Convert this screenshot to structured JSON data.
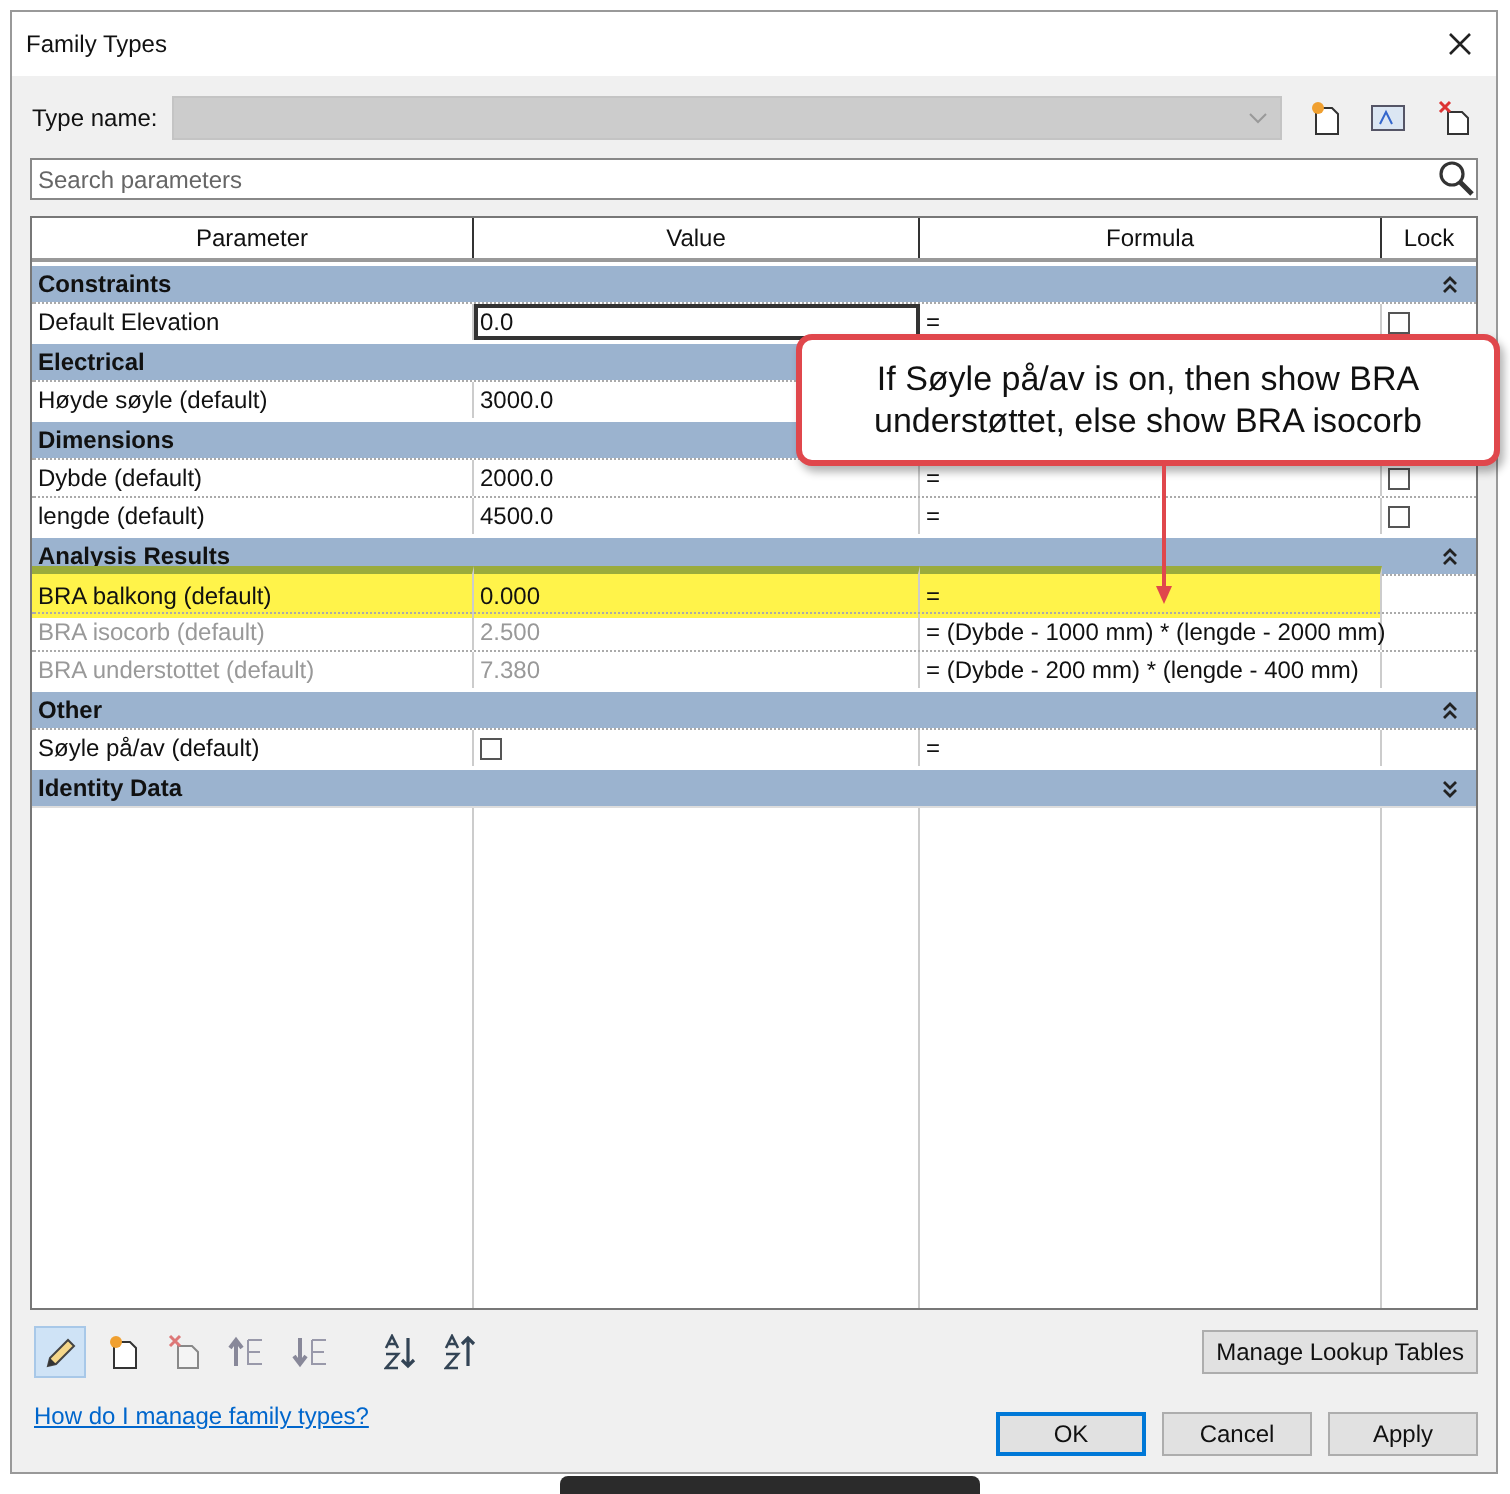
{
  "window": {
    "title": "Family Types"
  },
  "type_name": {
    "label": "Type name:"
  },
  "search": {
    "placeholder": "Search parameters"
  },
  "table": {
    "columns": [
      "Parameter",
      "Value",
      "Formula",
      "Lock"
    ],
    "groups": [
      {
        "name": "Constraints",
        "expanded": true,
        "rows": [
          {
            "parameter": "Default Elevation",
            "kind": "text",
            "value": "0.0",
            "editing": true,
            "formula": "=",
            "locked": false,
            "disabled": false,
            "highlighted": false
          }
        ]
      },
      {
        "name": "Electrical",
        "rows": [
          {
            "parameter": "Høyde søyle (default)",
            "kind": "text",
            "value": "3000.0",
            "editing": false,
            "disabled": false,
            "highlighted": false
          }
        ]
      },
      {
        "name": "Dimensions",
        "rows": [
          {
            "parameter": "Dybde (default)",
            "kind": "text",
            "value": "2000.0",
            "editing": false,
            "formula": "=",
            "locked": false,
            "disabled": false,
            "highlighted": false
          },
          {
            "parameter": "lengde (default)",
            "kind": "text",
            "value": "4500.0",
            "editing": false,
            "formula": "=",
            "locked": false,
            "disabled": false,
            "highlighted": false
          }
        ]
      },
      {
        "name": "Analysis Results",
        "expanded": true,
        "rows": [
          {
            "parameter": "BRA balkong (default)",
            "kind": "text",
            "value": "0.000",
            "editing": false,
            "formula": "=",
            "disabled": false,
            "highlighted": true
          },
          {
            "parameter": "BRA isocorb (default)",
            "kind": "text",
            "value": "2.500",
            "editing": false,
            "formula": "= (Dybde - 1000 mm) * (lengde - 2000 mm)",
            "disabled": true,
            "highlighted": false
          },
          {
            "parameter": "BRA understottet (default)",
            "kind": "text",
            "value": "7.380",
            "editing": false,
            "formula": "= (Dybde - 200 mm) * (lengde - 400 mm)",
            "disabled": true,
            "highlighted": false
          }
        ]
      },
      {
        "name": "Other",
        "expanded": true,
        "rows": [
          {
            "parameter": "Søyle på/av (default)",
            "kind": "checkbox",
            "checked": false,
            "editing": false,
            "formula": "=",
            "disabled": false,
            "highlighted": false
          }
        ]
      },
      {
        "name": "Identity Data",
        "expanded": false
      }
    ]
  },
  "callout": {
    "text": "If Søyle på/av is on, then show BRA understøttet, else show BRA isocorb"
  },
  "toolbar": [
    {
      "kind": "pencil",
      "selected": true
    },
    {
      "kind": "new",
      "selected": false
    },
    {
      "kind": "delete",
      "selected": false
    },
    {
      "kind": "up",
      "selected": false
    },
    {
      "kind": "down",
      "selected": false
    },
    {
      "kind": "sort-asc",
      "selected": false
    },
    {
      "kind": "sort-desc",
      "selected": false
    }
  ],
  "lookup_button": "Manage Lookup Tables",
  "help_link": "How do I manage family types?",
  "buttons": [
    {
      "label": "OK",
      "default": true
    },
    {
      "label": "Cancel",
      "default": false
    },
    {
      "label": "Apply",
      "default": false
    }
  ]
}
